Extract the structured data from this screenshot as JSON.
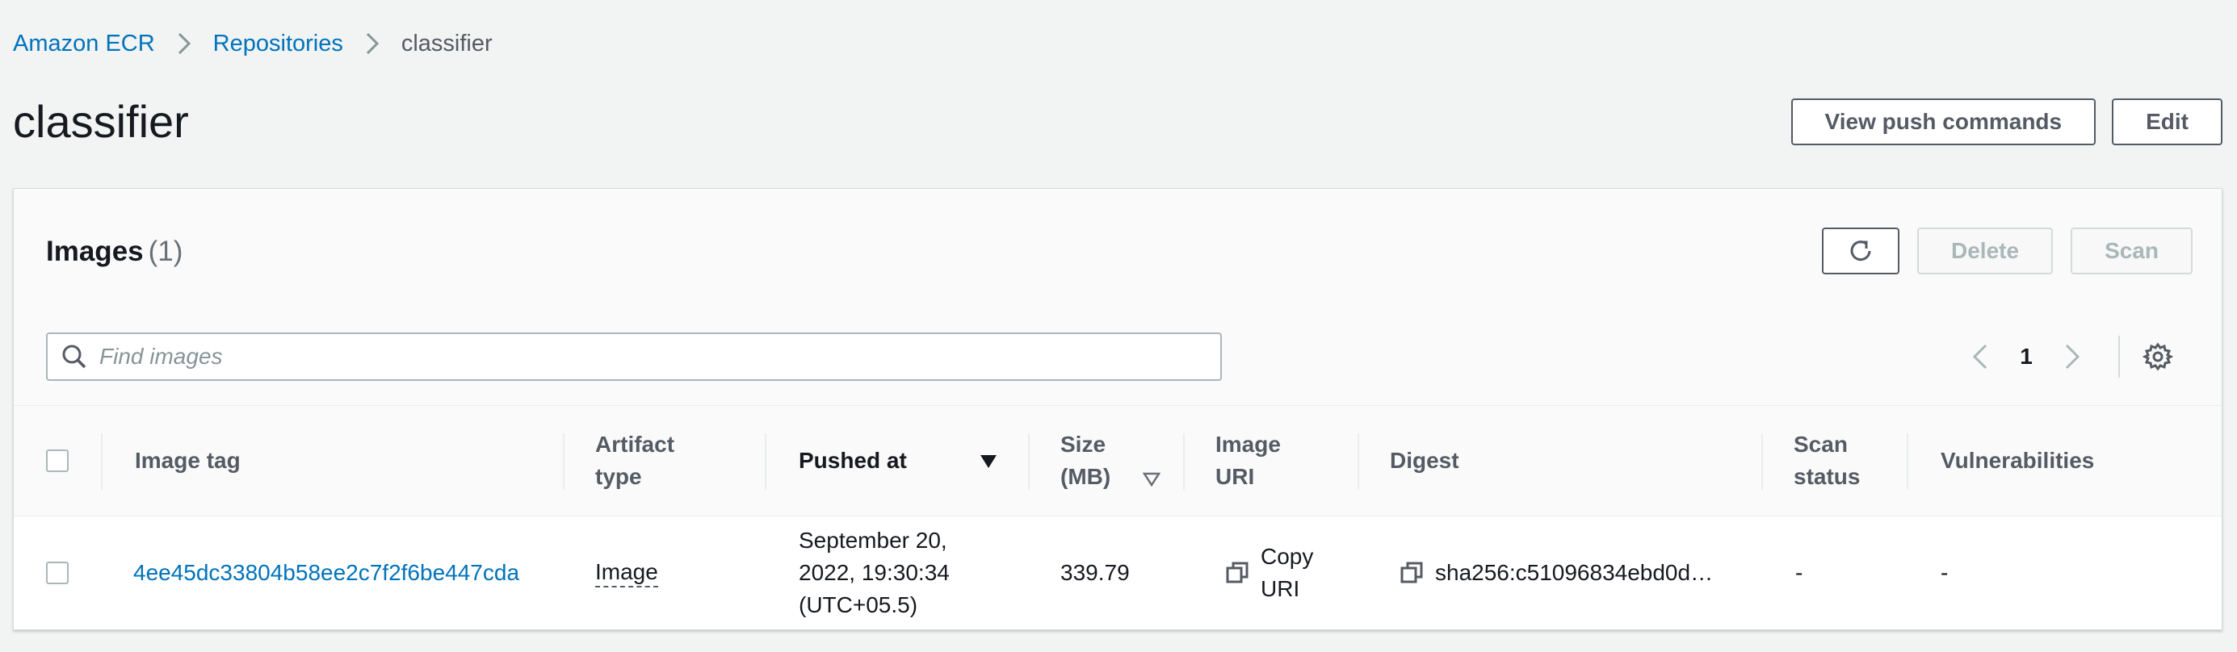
{
  "breadcrumb": {
    "items": [
      "Amazon ECR",
      "Repositories"
    ],
    "current": "classifier"
  },
  "page": {
    "title": "classifier",
    "view_push_label": "View push commands",
    "edit_label": "Edit"
  },
  "panel": {
    "title": "Images",
    "count": "(1)",
    "delete_label": "Delete",
    "scan_label": "Scan",
    "search_placeholder": "Find images",
    "page_number": "1"
  },
  "table": {
    "headers": {
      "image_tag": "Image tag",
      "artifact_type_1": "Artifact",
      "artifact_type_2": "type",
      "pushed_at": "Pushed at",
      "size_1": "Size",
      "size_2": "(MB)",
      "image_uri_1": "Image",
      "image_uri_2": "URI",
      "digest": "Digest",
      "scan_status_1": "Scan",
      "scan_status_2": "status",
      "vulnerabilities": "Vulnerabilities"
    },
    "rows": [
      {
        "image_tag": "4ee45dc33804b58ee2c7f2f6be447cda",
        "artifact_type": "Image",
        "pushed_at_1": "September 20,",
        "pushed_at_2": "2022, 19:30:34",
        "pushed_at_3": "(UTC+05.5)",
        "size": "339.79",
        "copy_uri_1": "Copy",
        "copy_uri_2": "URI",
        "digest": "sha256:c51096834ebd0d…",
        "scan_status": "-",
        "vulnerabilities": "-"
      }
    ]
  },
  "icons": {
    "refresh": "refresh-icon",
    "search": "search-icon",
    "settings": "gear-icon",
    "copy": "copy-icon",
    "sort_desc": "sort-descending-icon",
    "sort_neutral": "sort-neutral-icon"
  },
  "colors": {
    "link": "#0073bb",
    "background": "#f2f3f3"
  }
}
